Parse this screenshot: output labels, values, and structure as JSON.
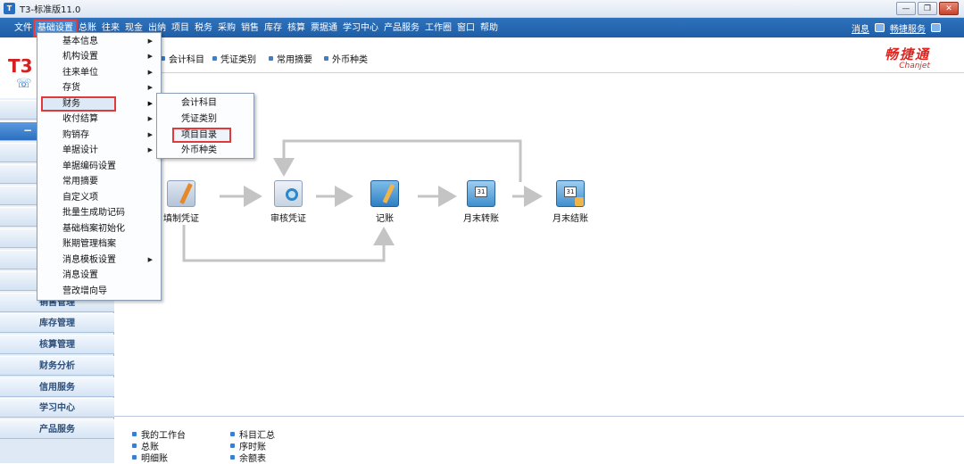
{
  "window": {
    "title": "T3-标准版11.0"
  },
  "menubar": {
    "items": [
      "文件",
      "基础设置",
      "总账",
      "往来",
      "现金",
      "出纳",
      "项目",
      "税务",
      "采购",
      "销售",
      "库存",
      "核算",
      "票据通",
      "学习中心",
      "产品服务",
      "工作圈",
      "窗口",
      "帮助"
    ],
    "right": {
      "messages": "消息",
      "service": "畅捷服务"
    }
  },
  "toolbar": {
    "items": [
      "会计科目",
      "凭证类别",
      "常用摘要",
      "外币种类"
    ],
    "brand_cn": "畅捷通",
    "brand_en": "Chanjet"
  },
  "logo": {
    "text": "T3"
  },
  "left_nav": {
    "items": [
      "销售管理",
      "库存管理",
      "核算管理",
      "财务分析",
      "信用服务",
      "学习中心",
      "产品服务"
    ]
  },
  "base_menu": {
    "items": [
      {
        "label": "基本信息",
        "has_sub": true
      },
      {
        "label": "机构设置",
        "has_sub": true
      },
      {
        "label": "往来单位",
        "has_sub": true
      },
      {
        "label": "存货",
        "has_sub": true
      },
      {
        "label": "财务",
        "has_sub": true
      },
      {
        "label": "收付结算",
        "has_sub": true
      },
      {
        "label": "购销存",
        "has_sub": true
      },
      {
        "label": "单据设计",
        "has_sub": true
      },
      {
        "label": "单据编码设置",
        "has_sub": false
      },
      {
        "label": "常用摘要",
        "has_sub": false
      },
      {
        "label": "自定义项",
        "has_sub": false
      },
      {
        "label": "批量生成助记码",
        "has_sub": false
      },
      {
        "label": "基础档案初始化",
        "has_sub": false
      },
      {
        "label": "账期管理档案",
        "has_sub": false
      },
      {
        "label": "消息模板设置",
        "has_sub": true
      },
      {
        "label": "消息设置",
        "has_sub": false
      },
      {
        "label": "营改增向导",
        "has_sub": false
      }
    ],
    "sub_arrow": "▶"
  },
  "finance_menu": {
    "items": [
      "会计科目",
      "凭证类别",
      "项目目录",
      "外币种类"
    ]
  },
  "flow": {
    "nodes": [
      "填制凭证",
      "审核凭证",
      "记账",
      "月末转账",
      "月末结账"
    ]
  },
  "bottom_links": {
    "col1": [
      "我的工作台",
      "总账",
      "明细账"
    ],
    "col2": [
      "科目汇总",
      "序时账",
      "余额表"
    ]
  },
  "colors": {
    "menubar": "#2468b4",
    "highlight_box": "#e23a3a",
    "brand": "#e0241e",
    "nav_text": "#2c4f7c"
  }
}
